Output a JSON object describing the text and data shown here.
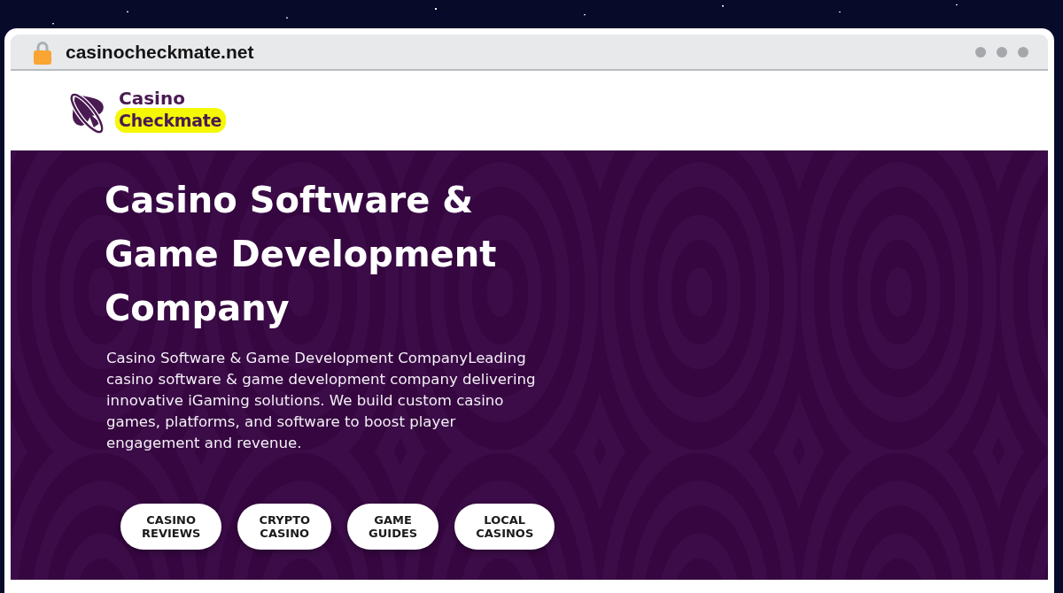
{
  "browser": {
    "url": "casinocheckmate.net",
    "secure": true
  },
  "header": {
    "logo": {
      "line_1": "Casino",
      "line_2": "Checkmate"
    }
  },
  "hero": {
    "title": "Casino Software & Game Development Company",
    "description": "Casino Software & Game Development CompanyLeading casino software & game development company delivering innovative iGaming solutions. We build custom casino games, platforms, and software to boost player engagement and revenue.",
    "buttons": [
      "CASINO REVIEWS",
      "CRYPTO CASINO",
      "GAME GUIDES",
      "LOCAL CASINOS"
    ]
  }
}
